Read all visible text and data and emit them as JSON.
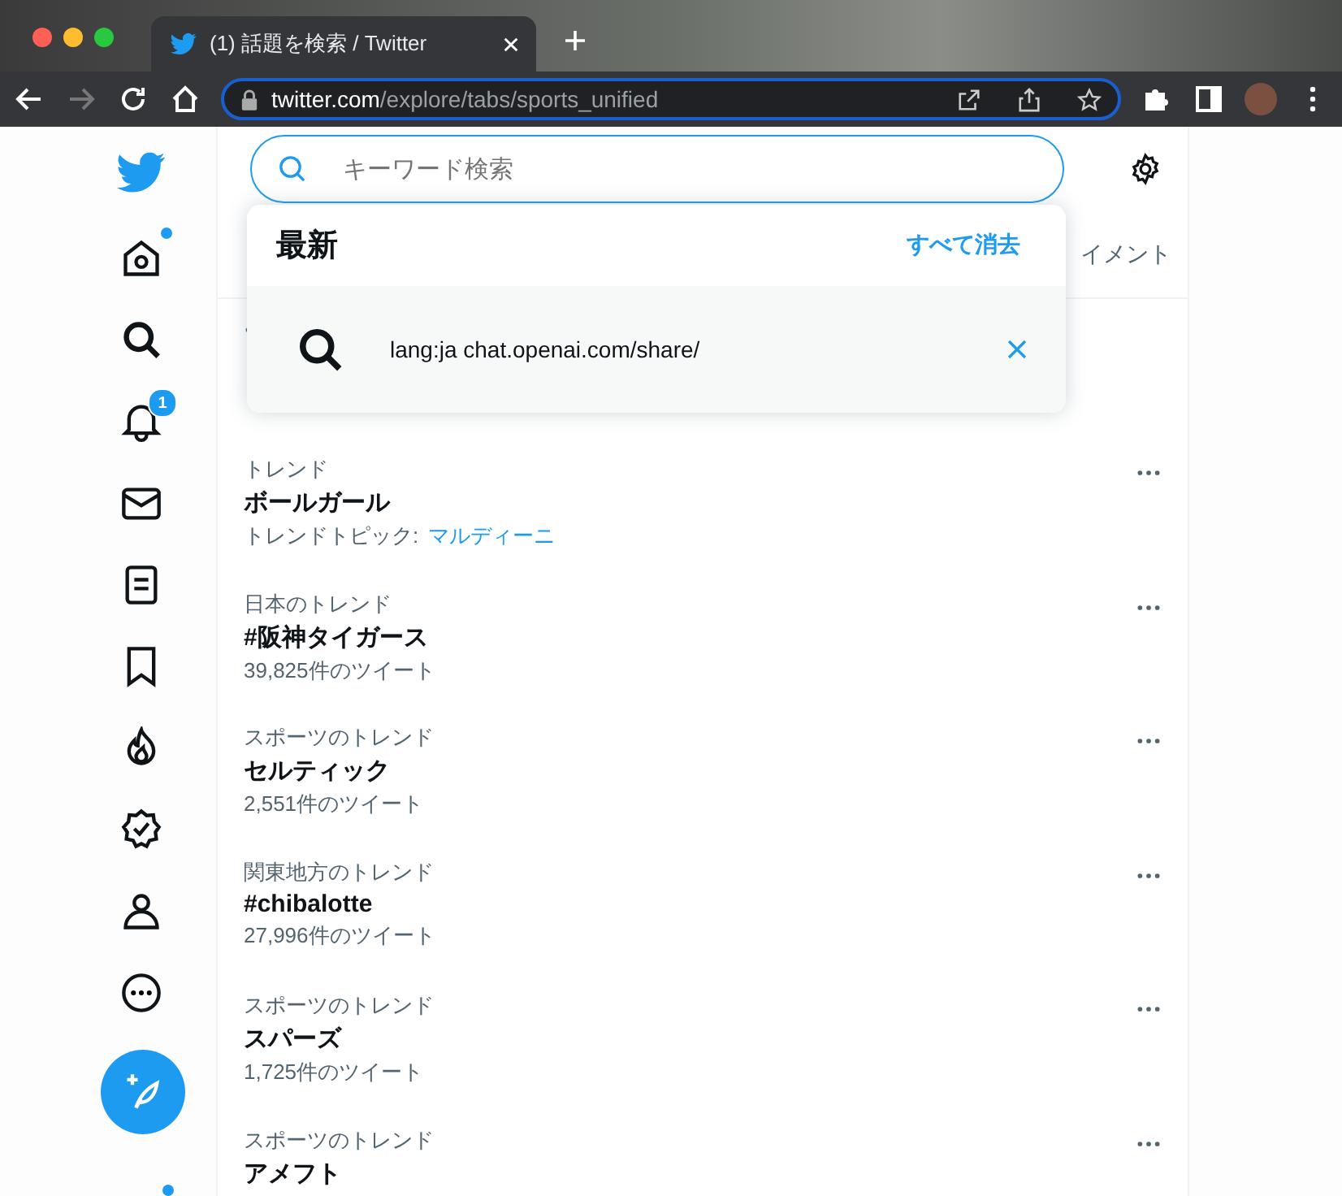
{
  "browser": {
    "tab": {
      "title": "(1) 話題を検索 / Twitter"
    },
    "address": {
      "host": "twitter.com",
      "path": "/explore/tabs/sports_unified"
    }
  },
  "sidebar": {
    "items": [
      {
        "kind": "home",
        "unread": true
      },
      {
        "kind": "explore",
        "unread": false
      },
      {
        "kind": "notifications",
        "unread": false,
        "badge": "1"
      },
      {
        "kind": "messages",
        "unread": false
      },
      {
        "kind": "lists",
        "unread": false
      },
      {
        "kind": "bookmarks",
        "unread": false
      },
      {
        "kind": "topics",
        "unread": false
      },
      {
        "kind": "verified",
        "unread": false
      },
      {
        "kind": "profile",
        "unread": false
      },
      {
        "kind": "more",
        "unread": false
      }
    ]
  },
  "search": {
    "placeholder": "キーワード検索"
  },
  "tabs_visible_part": "イメント",
  "recent": {
    "title": "最新",
    "clear_all": "すべて消去",
    "items": [
      {
        "query": "lang:ja chat.openai.com/share/"
      }
    ]
  },
  "trends": [
    {
      "context": "トレンド",
      "name": "ボールガール",
      "topic_label": "トレンドトピック:",
      "topic": "マルディーニ"
    },
    {
      "context": "日本のトレンド",
      "name": "#阪神タイガース",
      "count": "39,825件のツイート"
    },
    {
      "context": "スポーツのトレンド",
      "name": "セルティック",
      "count": "2,551件のツイート"
    },
    {
      "context": "関東地方のトレンド",
      "name": "#chibalotte",
      "count": "27,996件のツイート"
    },
    {
      "context": "スポーツのトレンド",
      "name": "スパーズ",
      "count": "1,725件のツイート"
    },
    {
      "context": "スポーツのトレンド",
      "name": "アメフト"
    }
  ]
}
